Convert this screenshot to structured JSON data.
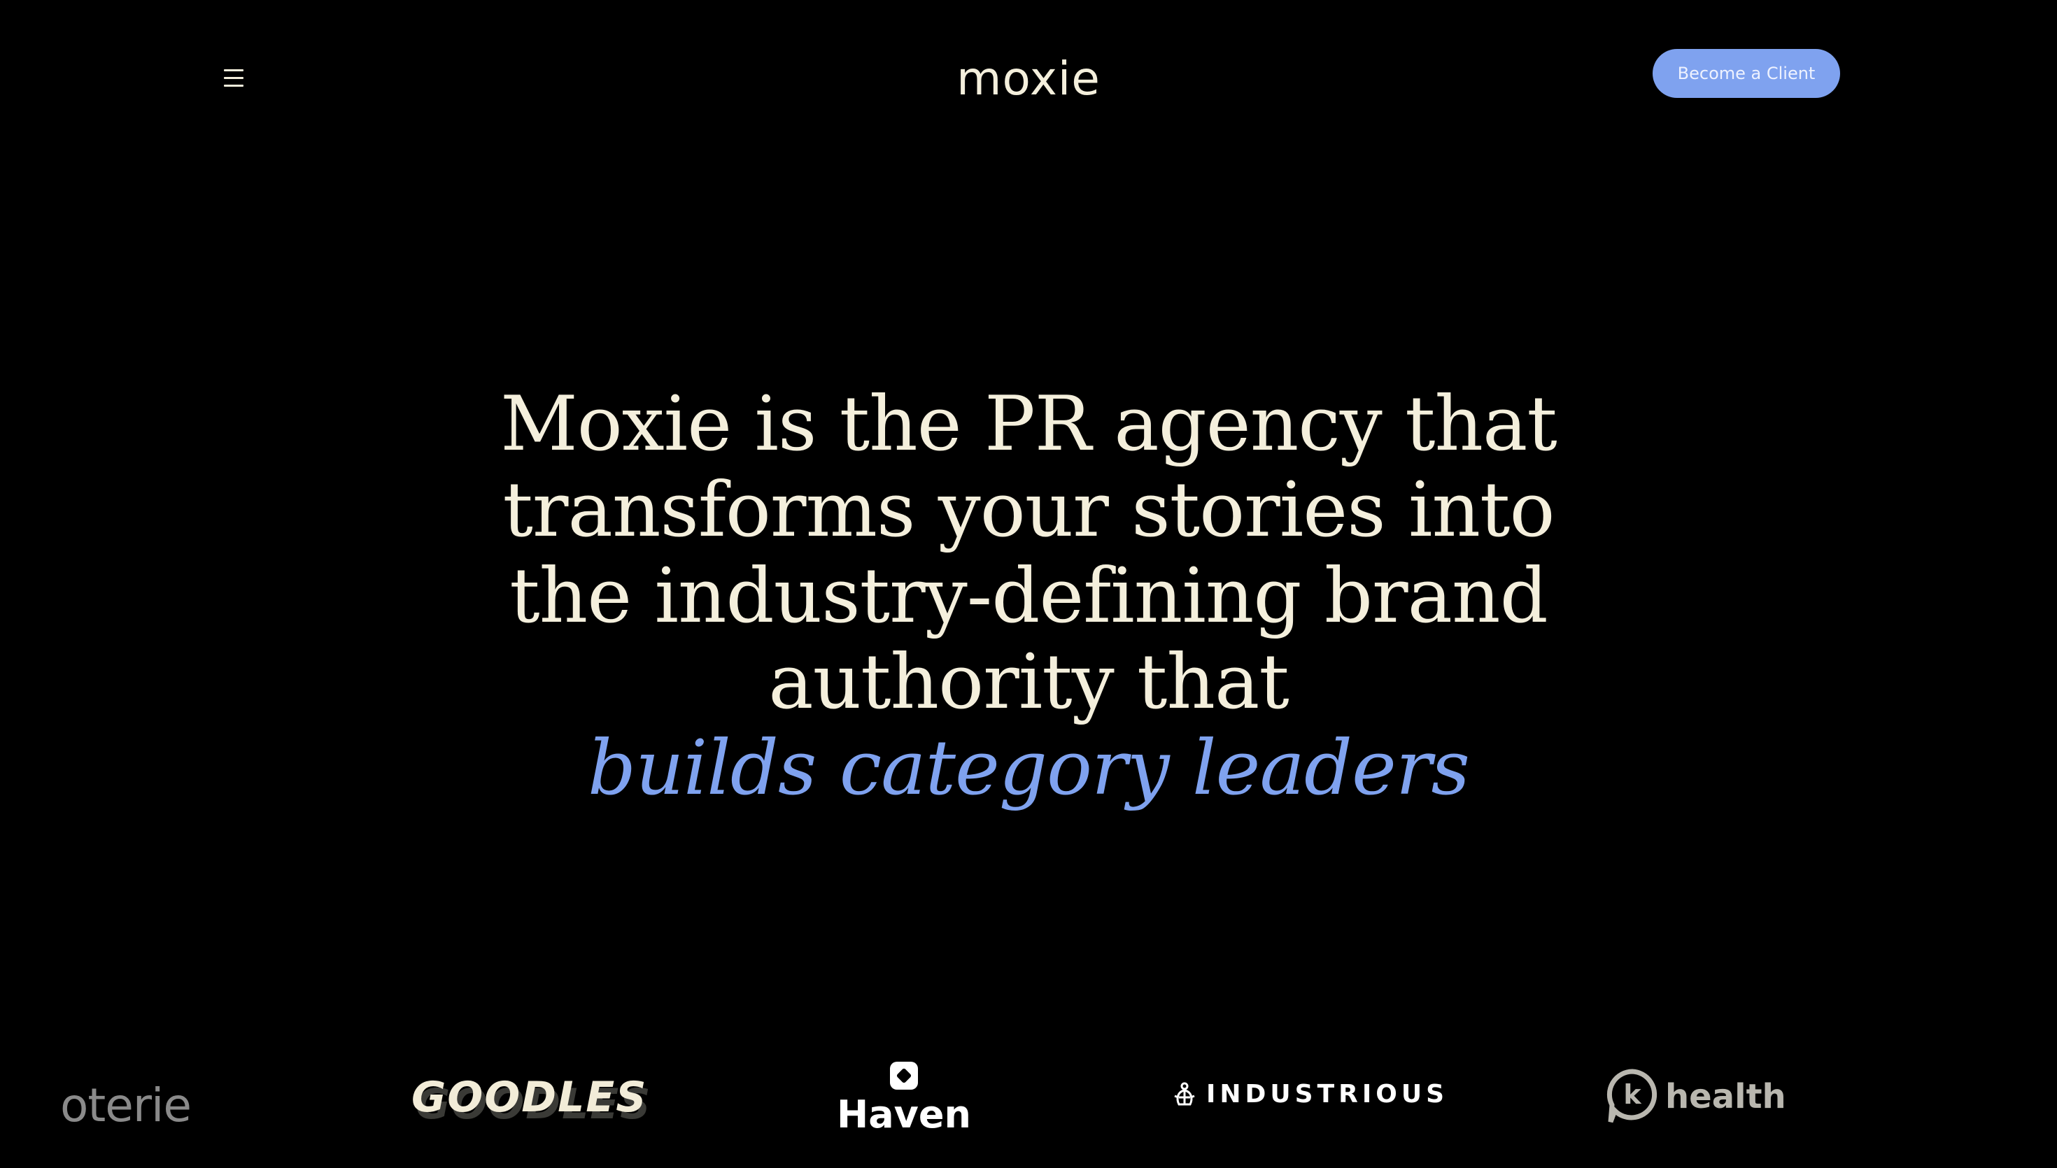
{
  "header": {
    "logo_text": "moxie",
    "cta_label": "Become a Client",
    "menu_icon": "hamburger-menu-icon"
  },
  "hero": {
    "lines": [
      "Moxie is the PR agency that",
      "transforms your stories into",
      "the industry-defining brand",
      "authority that"
    ],
    "accent": "builds category leaders"
  },
  "clients": {
    "logos": [
      {
        "name": "coterie",
        "text": "oterie"
      },
      {
        "name": "goodles",
        "text": "GOODLES"
      },
      {
        "name": "haven",
        "text": "Haven"
      },
      {
        "name": "industrious",
        "text": "INDUSTRIOUS"
      },
      {
        "name": "k-health",
        "text": "health"
      }
    ]
  },
  "colors": {
    "background": "#000000",
    "text": "#f4efdc",
    "accent": "#7fa2ef"
  }
}
